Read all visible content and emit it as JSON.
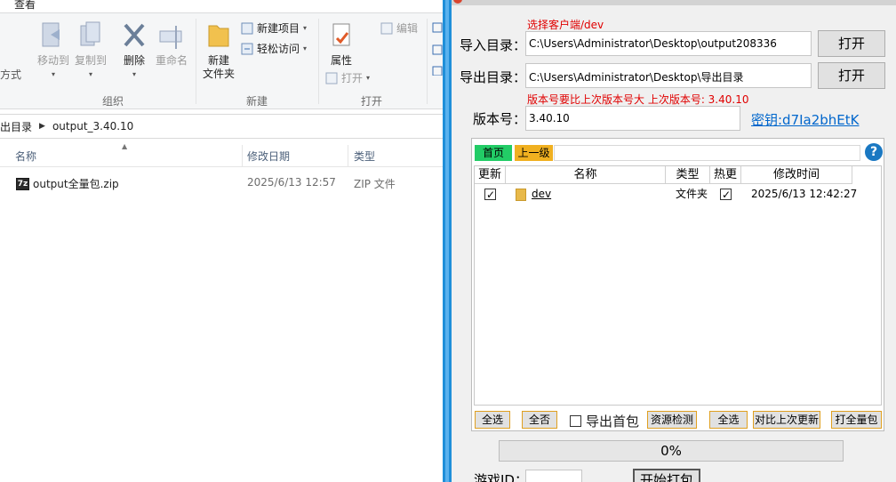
{
  "explorer": {
    "ribbon_tab": "查看",
    "ribbon": {
      "left_partial": "方式",
      "move_to": "移动到",
      "copy_to": "复制到",
      "delete": "删除",
      "rename": "重命名",
      "group_organize": "组织",
      "new_folder_line1": "新建",
      "new_folder_line2": "文件夹",
      "new_item": "新建项目",
      "easy_access": "轻松访问",
      "group_new": "新建",
      "properties": "属性",
      "edit": "编辑",
      "open": "打开",
      "group_open": "打开"
    },
    "address": {
      "parent": "出目录",
      "current": "output_3.40.10"
    },
    "columns": {
      "name": "名称",
      "date": "修改日期",
      "type": "类型"
    },
    "files": [
      {
        "name": "output全量包.zip",
        "date": "2025/6/13 12:57",
        "type": "ZIP 文件",
        "icon": "7z-archive-icon"
      }
    ]
  },
  "packer": {
    "client_note": "选择客户端/dev",
    "import_label": "导入目录：",
    "import_path": "C:\\Users\\Administrator\\Desktop\\output208336",
    "import_btn": "打开",
    "export_label": "导出目录：",
    "export_path": "C:\\Users\\Administrator\\Desktop\\导出目录",
    "export_btn": "打开",
    "version_note": "版本号要比上次版本号大  上次版本号: 3.40.10",
    "version_label": "版本号：",
    "version_value": "3.40.10",
    "key_link": "密钥:d7Ia2bhEtK",
    "nav_home": "首页",
    "nav_up": "上一级",
    "help": "?",
    "grid_headers": {
      "update": "更新",
      "name": "名称",
      "type": "类型",
      "hot": "热更",
      "mtime": "修改时间"
    },
    "rows": [
      {
        "update": true,
        "name": "dev",
        "type": "文件夹",
        "hot": true,
        "mtime": "2025/6/13 12:42:27"
      }
    ],
    "btn_select_all_1": "全选",
    "btn_select_none": "全否",
    "export_first_pkg": "导出首包",
    "btn_resource_check": "资源检测",
    "btn_select_all_2": "全选",
    "btn_compare_last": "对比上次更新",
    "btn_full_pkg": "打全量包",
    "progress_text": "0%",
    "progress_value": 0,
    "game_id_label": "游戏ID：",
    "start_btn": "开始打包",
    "colors": {
      "red_note": "#e00000",
      "link": "#0066cc",
      "nav_home": "#22cc66",
      "nav_up": "#f0b020",
      "help": "#1a78c2",
      "divider": "#1f8fd9"
    }
  }
}
